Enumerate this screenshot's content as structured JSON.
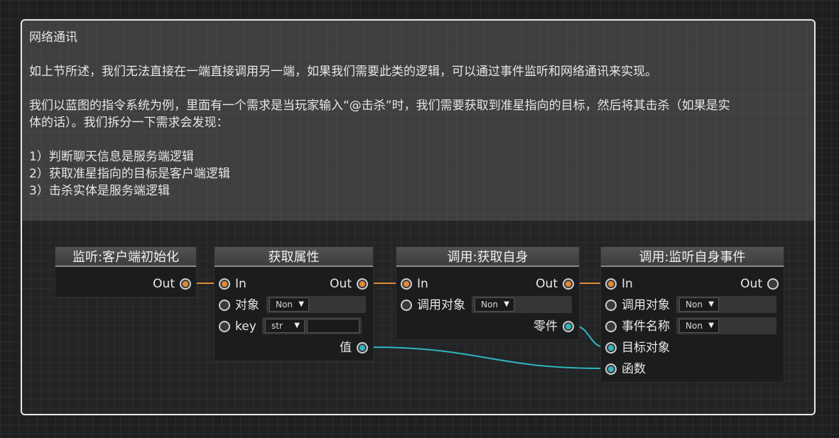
{
  "article": {
    "title": "网络通讯",
    "para1": "如上节所述，我们无法直接在一端直接调用另一端，如果我们需要此类的逻辑，可以通过事件监听和网络通讯来实现。",
    "para2_line1": "我们以蓝图的指令系统为例，里面有一个需求是当玩家输入“@击杀”时，我们需要获取到准星指向的目标，然后将其击杀（如果是实",
    "para2_line2": "体的话）。我们拆分一下需求会发现：",
    "list": [
      "1）判断聊天信息是服务端逻辑",
      "2）获取准星指向的目标是客户端逻辑",
      "3）击杀实体是服务端逻辑"
    ]
  },
  "nodes": {
    "listen_client_init": {
      "title": "监听:客户端初始化",
      "out_label": "Out"
    },
    "get_property": {
      "title": "获取属性",
      "in_label": "In",
      "out_label": "Out",
      "object_label": "对象",
      "object_value": "Non",
      "key_label": "key",
      "key_type": "str",
      "key_value": "",
      "value_label": "值"
    },
    "call_get_self": {
      "title": "调用:获取自身",
      "in_label": "In",
      "out_label": "Out",
      "call_target_label": "调用对象",
      "call_target_value": "Non",
      "part_label": "零件"
    },
    "call_listen_self_event": {
      "title": "调用:监听自身事件",
      "in_label": "In",
      "out_label": "Out",
      "call_target_label": "调用对象",
      "call_target_value": "Non",
      "event_name_label": "事件名称",
      "event_name_value": "Non",
      "target_object_label": "目标对象",
      "function_label": "函数"
    }
  },
  "colors": {
    "exec_wire": "#e38a34",
    "data_wire": "#2fb6c0",
    "panel_border": "#e8e8e8"
  }
}
